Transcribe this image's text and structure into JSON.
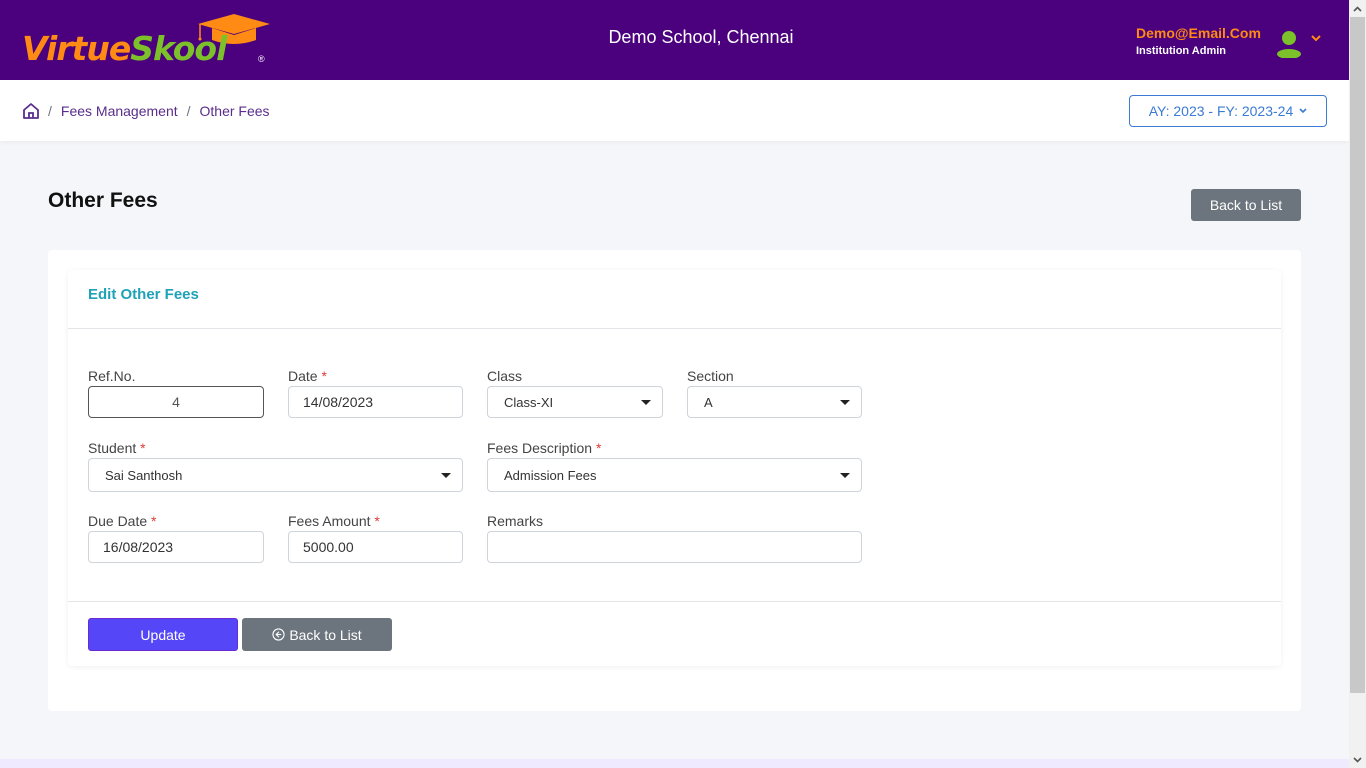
{
  "header": {
    "logo_part1": "Virtue",
    "logo_part2": "Skool",
    "logo_reg": "®",
    "school_name": "Demo School, Chennai",
    "user_email": "Demo@Email.Com",
    "user_role": "Institution Admin",
    "icons": {
      "avatar": "user-icon",
      "menu": "chevron-down-icon"
    }
  },
  "breadcrumb": {
    "home_icon": "home-icon",
    "separator": "/",
    "items": [
      "Fees Management",
      "Other Fees"
    ]
  },
  "year_selector": {
    "label": "AY: 2023 - FY: 2023-24"
  },
  "page": {
    "title": "Other Fees",
    "back_button": "Back to List"
  },
  "form": {
    "title": "Edit Other Fees",
    "fields": {
      "ref_no": {
        "label": "Ref.No.",
        "value": "4",
        "required": false
      },
      "date": {
        "label": "Date",
        "value": "14/08/2023",
        "required": true
      },
      "class": {
        "label": "Class",
        "value": "Class-XI",
        "required": false
      },
      "section": {
        "label": "Section",
        "value": "A",
        "required": false
      },
      "student": {
        "label": "Student",
        "value": "Sai Santhosh",
        "required": true
      },
      "fees_description": {
        "label": "Fees Description",
        "value": "Admission Fees",
        "required": true
      },
      "due_date": {
        "label": "Due Date",
        "value": "16/08/2023",
        "required": true
      },
      "fees_amount": {
        "label": "Fees Amount",
        "value": "5000.00",
        "required": true
      },
      "remarks": {
        "label": "Remarks",
        "value": "",
        "required": false
      }
    },
    "required_marker": "*",
    "update_button": "Update",
    "back_button": "Back to List"
  },
  "colors": {
    "brand_purple": "#4b007d",
    "logo_orange": "#ff8a14",
    "logo_green": "#7dc12a",
    "accent_teal": "#1fa2b8",
    "primary_button": "#5546f8",
    "secondary_button": "#6c757d",
    "link": "#5a2d8c",
    "selector_blue": "#3a7bd5"
  }
}
